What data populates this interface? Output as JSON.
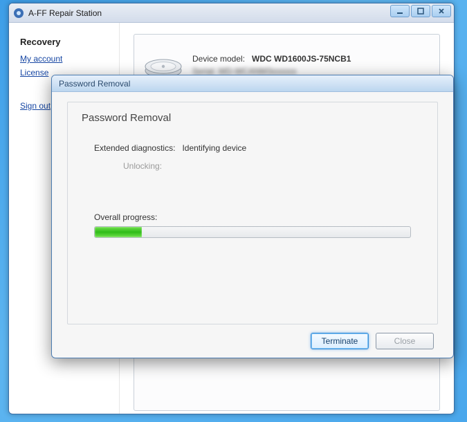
{
  "mainWindow": {
    "title": "A-FF Repair Station"
  },
  "sidebar": {
    "heading": "Recovery",
    "links": {
      "account": "My account",
      "license": "License",
      "signout": "Sign out"
    }
  },
  "device": {
    "modelLabel": "Device model:",
    "modelValue": "WDC WD1600JS-75NCB1",
    "serialMasked": "Serial:   WD-WCANM3xxxxxx"
  },
  "dialog": {
    "title": "Password Removal",
    "heading": "Password Removal",
    "diagLabel": "Extended diagnostics:",
    "diagValue": "Identifying device",
    "unlockLabel": "Unlocking:",
    "progressLabel": "Overall progress:",
    "progressPercent": 15,
    "buttons": {
      "terminate": "Terminate",
      "close": "Close"
    }
  }
}
